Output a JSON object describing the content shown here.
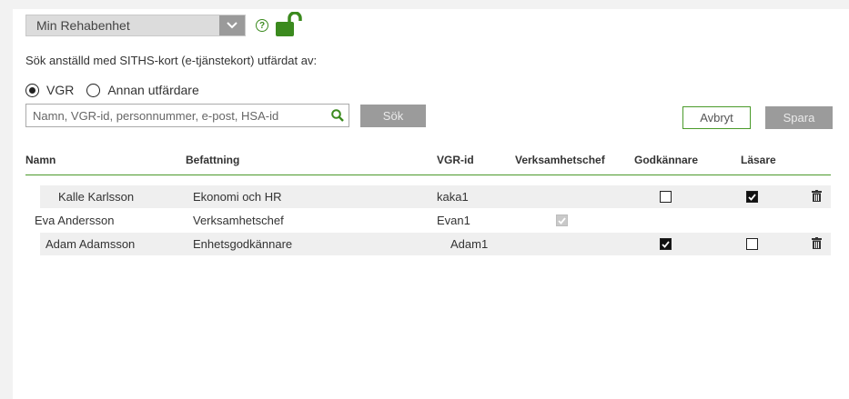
{
  "unit_selector": {
    "value": "Min Rehabenhet"
  },
  "help": {
    "glyph": "?"
  },
  "search": {
    "description": "Sök anställd med SITHS-kort (e-tjänstekort) utfärdat av:",
    "issuers": [
      {
        "label": "VGR",
        "selected": true
      },
      {
        "label": "Annan utfärdare",
        "selected": false
      }
    ],
    "placeholder": "Namn, VGR-id, personnummer, e-post, HSA-id",
    "button_label": "Sök"
  },
  "actions": {
    "cancel_label": "Avbryt",
    "save_label": "Spara"
  },
  "table": {
    "columns": [
      "Namn",
      "Befattning",
      "VGR-id",
      "Verksamhetschef",
      "Godkännare",
      "Läsare"
    ],
    "rows": [
      {
        "name": "Kalle Karlsson",
        "title": "Ekonomi och HR",
        "vgr_id": "kaka1",
        "verksamhetschef": null,
        "godkannare": false,
        "lasare": true,
        "deletable": true
      },
      {
        "name": "Eva Andersson",
        "title": "Verksamhetschef",
        "vgr_id": "Evan1",
        "verksamhetschef": true,
        "godkannare": null,
        "lasare": null,
        "deletable": false
      },
      {
        "name": "Adam Adamsson",
        "title": "Enhetsgodkännare",
        "vgr_id": "Adam1",
        "verksamhetschef": null,
        "godkannare": true,
        "lasare": false,
        "deletable": true
      }
    ]
  },
  "colors": {
    "accent_green": "#4a9a2a",
    "lock_green": "#3b8a1e",
    "button_gray": "#9b9b9b"
  }
}
